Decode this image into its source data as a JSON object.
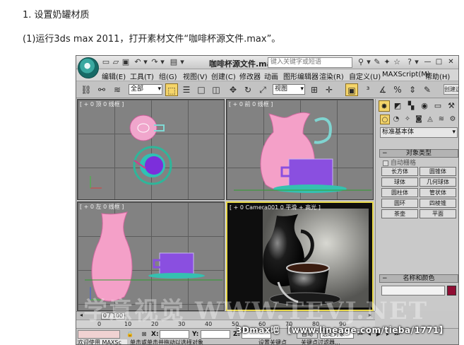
{
  "doc": {
    "step_heading": "1. 设置奶罐材质",
    "instruction": "(1)运行3ds max 2011，打开素材文件“咖啡杯源文件.max”。"
  },
  "window": {
    "title": "咖啡杯源文件.max",
    "search_placeholder": "键入关键字或短语",
    "minimize": "—",
    "maximize": "□",
    "close": "✕"
  },
  "menu": [
    "编辑(E)",
    "工具(T)",
    "组(G)",
    "视图(V)",
    "创建(C)",
    "修改器",
    "动画",
    "图形编辑器",
    "渲染(R)",
    "自定义(U)",
    "MAXScript(M)",
    "帮助(H)"
  ],
  "toolbar": {
    "selection_filter": "全部",
    "reference_coord": "视图",
    "right_field": "创建选"
  },
  "viewports": {
    "top": "[ + 0 顶 0 线框 ]",
    "front": "[ + 0 前 0 线框 ]",
    "left": "[ + 0 左 0 线框 ]",
    "camera": "[ + 0 Camera001 0 平滑 + 高光 ]"
  },
  "command_panel": {
    "category": "标准基本体",
    "object_type_title": "对象类型",
    "autogrid": "自动栅格",
    "buttons": [
      "长方体",
      "圆锥体",
      "球体",
      "几何球体",
      "圆柱体",
      "管状体",
      "圆环",
      "四棱锥",
      "茶壶",
      "平面"
    ],
    "name_color_title": "名称和颜色"
  },
  "timeline": {
    "position": "0 / 100",
    "ticks": [
      "0",
      "10",
      "20",
      "30",
      "40",
      "50",
      "60",
      "70",
      "80",
      "90"
    ]
  },
  "status": {
    "x_label": "X:",
    "y_label": "Y:",
    "z_label": "Z:",
    "welcome": "欢迎使用 MAXSc",
    "prompt": "单击或单击并拖动以选择对象",
    "set_key": "设置关键点",
    "key_filter": "关键点过滤器...",
    "auto_key": "自动",
    "selected_object": "选定对象"
  },
  "overlay": {
    "credit": "3Dmax吧 【www.lineage.com/tieba/1771】",
    "watermark": "学意视觉 WWW.TEVJ.NET"
  }
}
